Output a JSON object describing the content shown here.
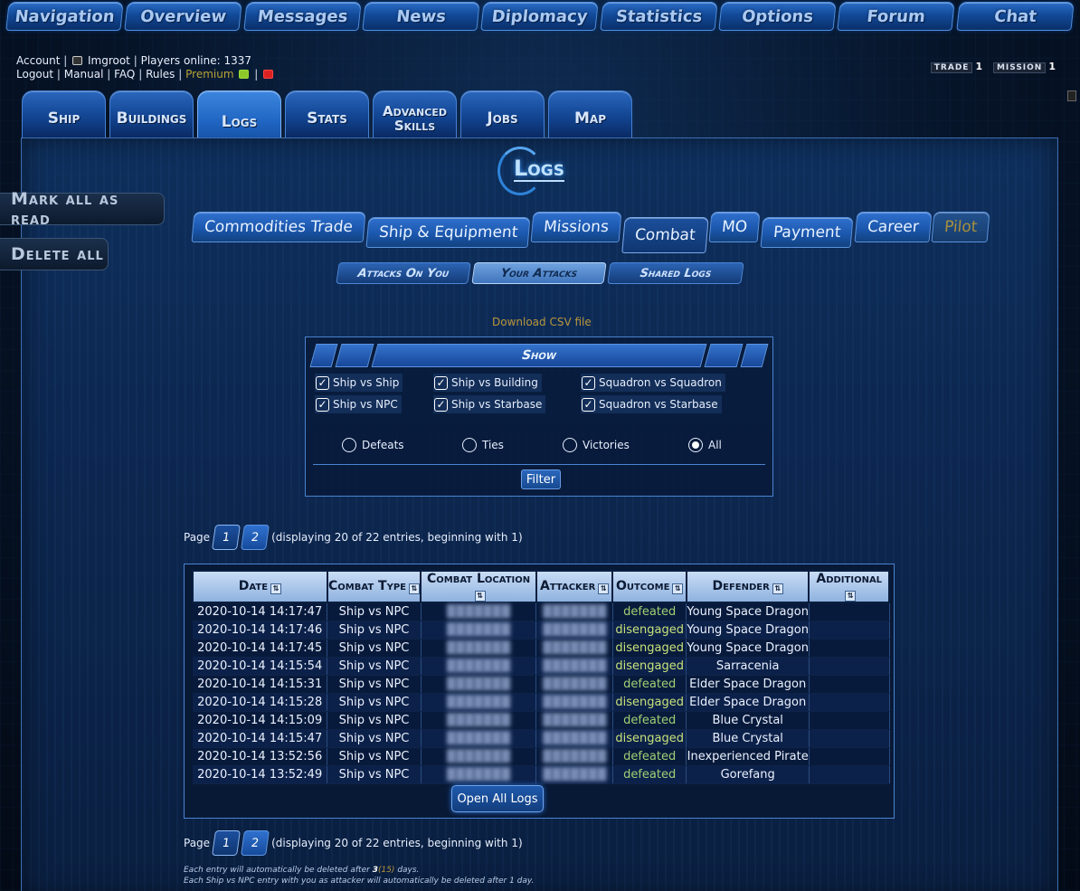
{
  "topnav": [
    "Navigation",
    "Overview",
    "Messages",
    "News",
    "Diplomacy",
    "Statistics",
    "Options",
    "Forum",
    "Chat"
  ],
  "account": {
    "account_label": "Account",
    "username": "Imgroot",
    "players_online": "Players online: 1337",
    "logout": "Logout",
    "manual": "Manual",
    "faq": "FAQ",
    "rules": "Rules",
    "premium": "Premium"
  },
  "status": {
    "trade_label": "TRADE",
    "trade_value": "1",
    "mission_label": "MISSION",
    "mission_value": "1"
  },
  "maintabs": [
    "Ship",
    "Buildings",
    "Logs",
    "Stats",
    "Advanced Skills",
    "Jobs",
    "Map"
  ],
  "page_title": "Logs",
  "side": {
    "mark_all": "Mark all as read",
    "delete_all": "Delete all"
  },
  "cattabs": [
    "Commodities Trade",
    "Ship & Equipment",
    "Missions",
    "Combat",
    "MO",
    "Payment",
    "Career",
    "Pilot"
  ],
  "subtabs": [
    "Attacks On You",
    "Your Attacks",
    "Shared Logs"
  ],
  "csv_link": "Download CSV file",
  "filter": {
    "title": "Show",
    "checks": [
      "Ship vs Ship",
      "Ship vs Building",
      "Squadron vs Squadron",
      "Ship vs NPC",
      "Ship vs Starbase",
      "Squadron vs Starbase"
    ],
    "radios": [
      "Defeats",
      "Ties",
      "Victories",
      "All"
    ],
    "selected_radio": "All",
    "button": "Filter"
  },
  "pager": {
    "label": "Page",
    "pages": [
      "1",
      "2"
    ],
    "info": "(displaying 20 of 22 entries, beginning with 1)"
  },
  "table": {
    "headers": [
      "Date",
      "Combat Type",
      "Combat Location",
      "Attacker",
      "Outcome",
      "Defender",
      "Additional"
    ],
    "rows": [
      [
        "2020-10-14 14:17:47",
        "Ship vs NPC",
        "defeated",
        "Young Space Dragon"
      ],
      [
        "2020-10-14 14:17:46",
        "Ship vs NPC",
        "disengaged",
        "Young Space Dragon"
      ],
      [
        "2020-10-14 14:17:45",
        "Ship vs NPC",
        "disengaged",
        "Young Space Dragon"
      ],
      [
        "2020-10-14 14:15:54",
        "Ship vs NPC",
        "disengaged",
        "Sarracenia"
      ],
      [
        "2020-10-14 14:15:31",
        "Ship vs NPC",
        "defeated",
        "Elder Space Dragon"
      ],
      [
        "2020-10-14 14:15:28",
        "Ship vs NPC",
        "disengaged",
        "Elder Space Dragon"
      ],
      [
        "2020-10-14 14:15:09",
        "Ship vs NPC",
        "defeated",
        "Blue Crystal"
      ],
      [
        "2020-10-14 14:15:47",
        "Ship vs NPC",
        "disengaged",
        "Blue Crystal"
      ],
      [
        "2020-10-14 13:52:56",
        "Ship vs NPC",
        "defeated",
        "Inexperienced Pirate"
      ],
      [
        "2020-10-14 13:52:49",
        "Ship vs NPC",
        "defeated",
        "Gorefang"
      ]
    ],
    "open_all": "Open All Logs"
  },
  "notes": {
    "line1_a": "Each entry will automatically be deleted after",
    "line1_days": "3",
    "line1_alt": "(15)",
    "line1_b": "days.",
    "line2": "Each Ship vs NPC entry with you as attacker will automatically be deleted after 1 day."
  }
}
